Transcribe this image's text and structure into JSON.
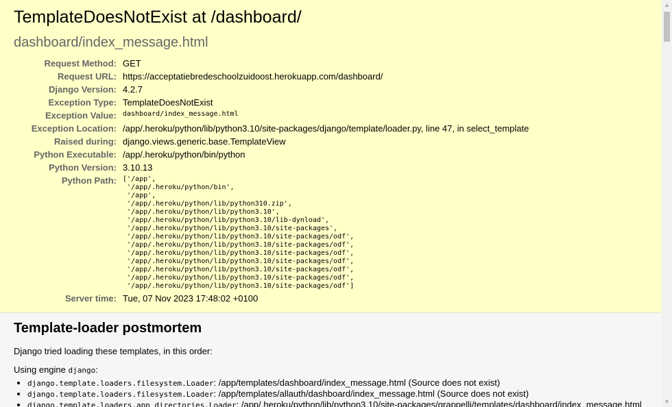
{
  "summary": {
    "title": "TemplateDoesNotExist at /dashboard/",
    "subtitle": "dashboard/index_message.html",
    "rows": [
      {
        "label": "Request Method:",
        "value": "GET"
      },
      {
        "label": "Request URL:",
        "value": "https://acceptatiebredeschoolzuidoost.herokuapp.com/dashboard/"
      },
      {
        "label": "Django Version:",
        "value": "4.2.7"
      },
      {
        "label": "Exception Type:",
        "value": "TemplateDoesNotExist"
      },
      {
        "label": "Exception Value:",
        "value": "dashboard/index_message.html"
      },
      {
        "label": "Exception Location:",
        "value": "/app/.heroku/python/lib/python3.10/site-packages/django/template/loader.py, line 47, in select_template"
      },
      {
        "label": "Raised during:",
        "value": "django.views.generic.base.TemplateView"
      },
      {
        "label": "Python Executable:",
        "value": "/app/.heroku/python/bin/python"
      },
      {
        "label": "Python Version:",
        "value": "3.10.13"
      },
      {
        "label": "Python Path:",
        "value": "['/app',\n '/app/.heroku/python/bin',\n '/app',\n '/app/.heroku/python/lib/python310.zip',\n '/app/.heroku/python/lib/python3.10',\n '/app/.heroku/python/lib/python3.10/lib-dynload',\n '/app/.heroku/python/lib/python3.10/site-packages',\n '/app/.heroku/python/lib/python3.10/site-packages/odf',\n '/app/.heroku/python/lib/python3.10/site-packages/odf',\n '/app/.heroku/python/lib/python3.10/site-packages/odf',\n '/app/.heroku/python/lib/python3.10/site-packages/odf',\n '/app/.heroku/python/lib/python3.10/site-packages/odf',\n '/app/.heroku/python/lib/python3.10/site-packages/odf',\n '/app/.heroku/python/lib/python3.10/site-packages/odf']"
      },
      {
        "label": "Server time:",
        "value": "Tue, 07 Nov 2023 17:48:02 +0100"
      }
    ]
  },
  "postmortem": {
    "title": "Template-loader postmortem",
    "intro": "Django tried loading these templates, in this order:",
    "engine_prefix": "Using engine ",
    "engine_name": "django",
    "engine_suffix": ":",
    "loaders": [
      {
        "loader": "django.template.loaders.filesystem.Loader",
        "path": ": /app/templates/dashboard/index_message.html (Source does not exist)"
      },
      {
        "loader": "django.template.loaders.filesystem.Loader",
        "path": ": /app/templates/allauth/dashboard/index_message.html (Source does not exist)"
      },
      {
        "loader": "django.template.loaders.app_directories.Loader",
        "path": ": /app/.heroku/python/lib/python3.10/site-packages/grappelli/templates/dashboard/index_message.html"
      }
    ]
  },
  "scrollbar": {
    "up_icon": "▲",
    "down_icon": "▼"
  }
}
